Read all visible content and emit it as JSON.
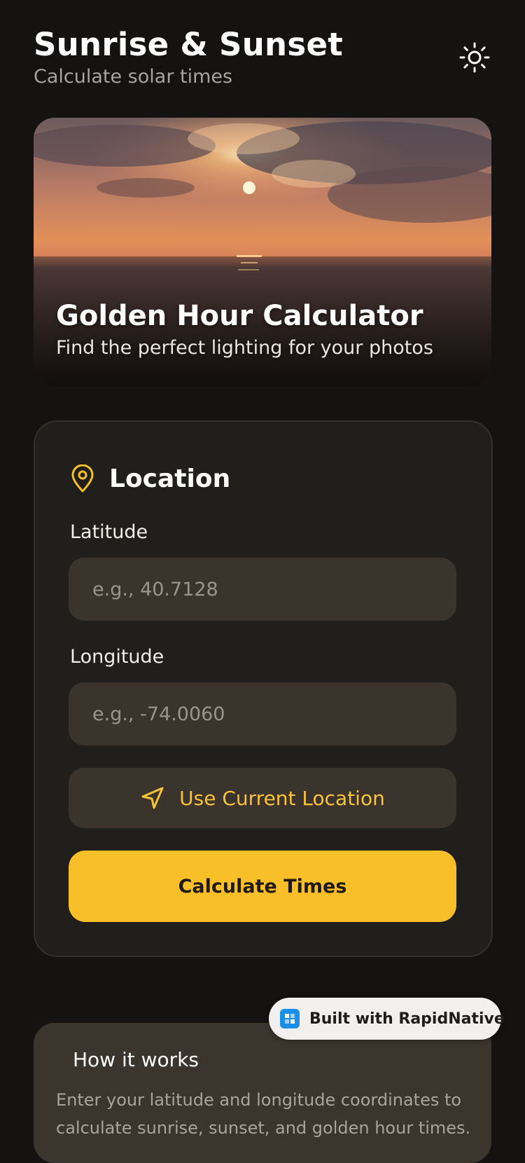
{
  "header": {
    "title": "Sunrise & Sunset",
    "subtitle": "Calculate solar times",
    "theme_icon": "sun-icon"
  },
  "hero": {
    "title": "Golden Hour Calculator",
    "subtitle": "Find the perfect lighting for your photos"
  },
  "location_card": {
    "title": "Location",
    "icon": "map-pin-icon",
    "latitude": {
      "label": "Latitude",
      "placeholder": "e.g., 40.7128",
      "value": ""
    },
    "longitude": {
      "label": "Longitude",
      "placeholder": "e.g., -74.0060",
      "value": ""
    },
    "use_location_label": "Use Current Location",
    "use_location_icon": "navigation-arrow-icon",
    "calculate_label": "Calculate Times"
  },
  "info": {
    "title": "How it works",
    "body": "Enter your latitude and longitude coordinates to calculate sunrise, sunset, and golden hour times."
  },
  "badge": {
    "label": "Built with RapidNative"
  },
  "colors": {
    "background": "#141312",
    "card": "#211f1c",
    "input": "#3a342c",
    "accent": "#f9bf28",
    "accent_text": "#f8c23a"
  }
}
